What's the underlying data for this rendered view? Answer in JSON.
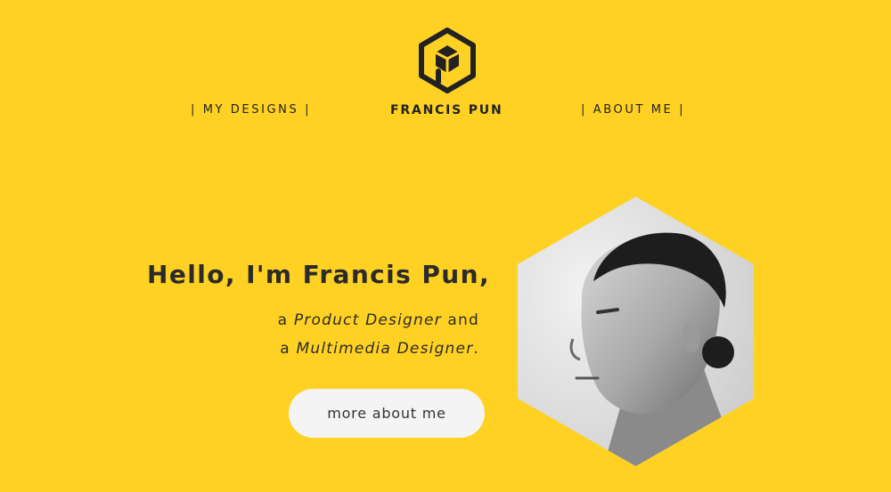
{
  "header": {
    "logo_icon": "hexagon-cube-logo-icon",
    "nav_left": "| MY DESIGNS |",
    "brand": "FRANCIS PUN",
    "nav_right": "| ABOUT ME |"
  },
  "hero": {
    "greeting": "Hello, I'm Francis Pun,",
    "role_1_prefix": "a ",
    "role_1_title": "Product Designer",
    "role_1_suffix": " and",
    "role_2_prefix": "a ",
    "role_2_title": "Multimedia Designer",
    "role_2_suffix": ".",
    "cta_label": "more about me"
  },
  "colors": {
    "background": "#ffd123",
    "text": "#2b2b2b",
    "button": "#f4f4f4"
  }
}
